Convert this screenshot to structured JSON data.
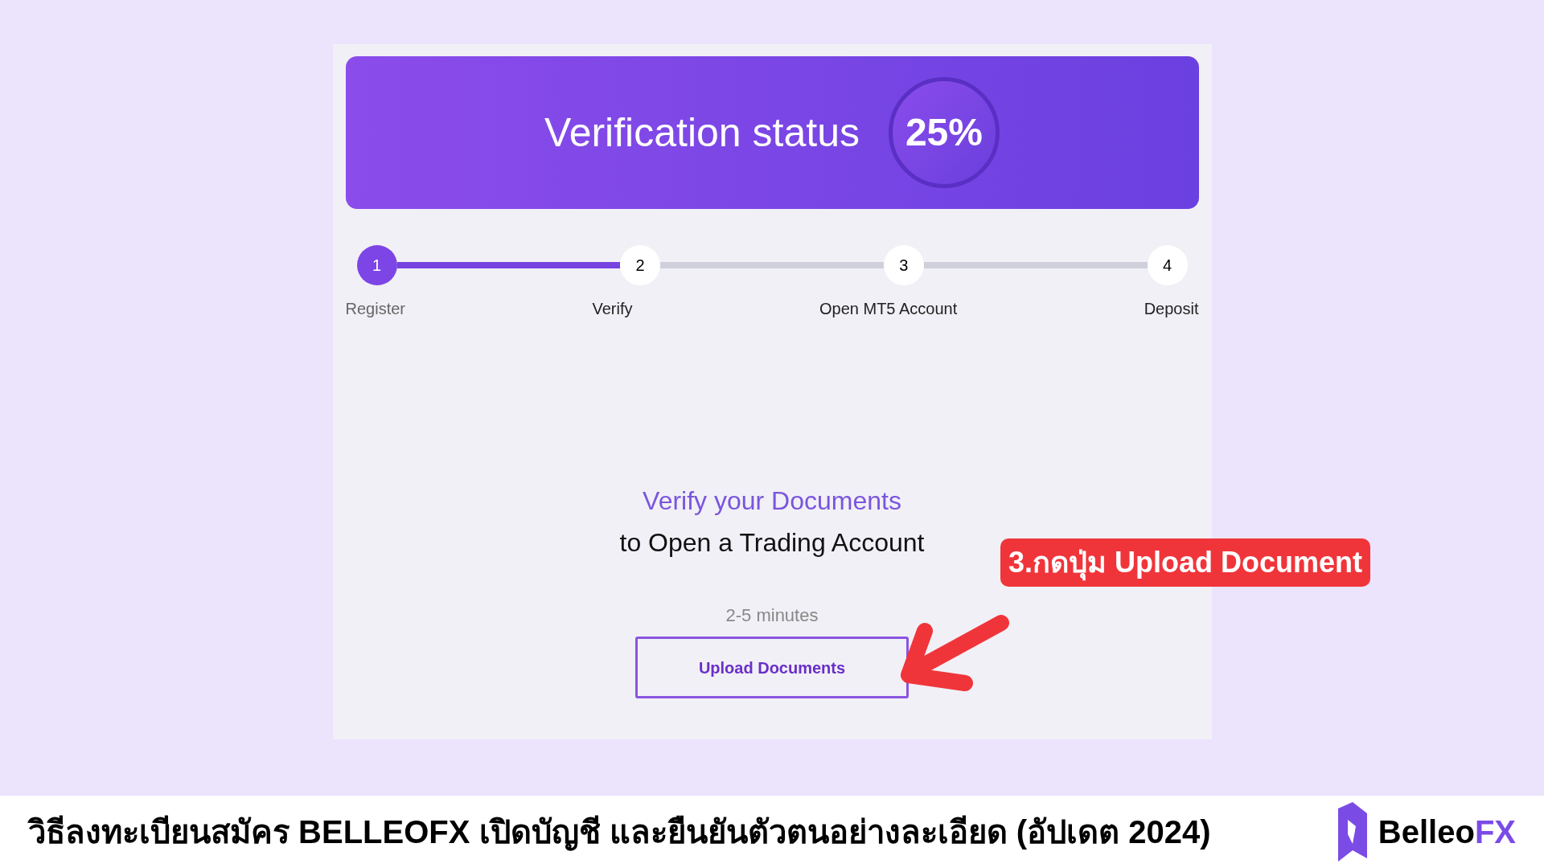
{
  "banner": {
    "title": "Verification status",
    "percent": "25%"
  },
  "steps": [
    {
      "number": "1",
      "label": "Register",
      "done": true
    },
    {
      "number": "2",
      "label": "Verify",
      "done": false
    },
    {
      "number": "3",
      "label": "Open MT5 Account",
      "done": false
    },
    {
      "number": "4",
      "label": "Deposit",
      "done": false
    }
  ],
  "content": {
    "heading": "Verify your Documents",
    "subheading": "to Open a Trading Account",
    "duration": "2-5 minutes",
    "button": "Upload Documents"
  },
  "callout": "3.กดปุ่ม Upload Document",
  "footer": {
    "title": "วิธีลงทะเบียนสมัคร BELLEOFX เปิดบัญชี และยืนยันตัวตนอย่างละเอียด (อัปเดต 2024)",
    "logo_main": "Belleo",
    "logo_accent": "FX"
  }
}
